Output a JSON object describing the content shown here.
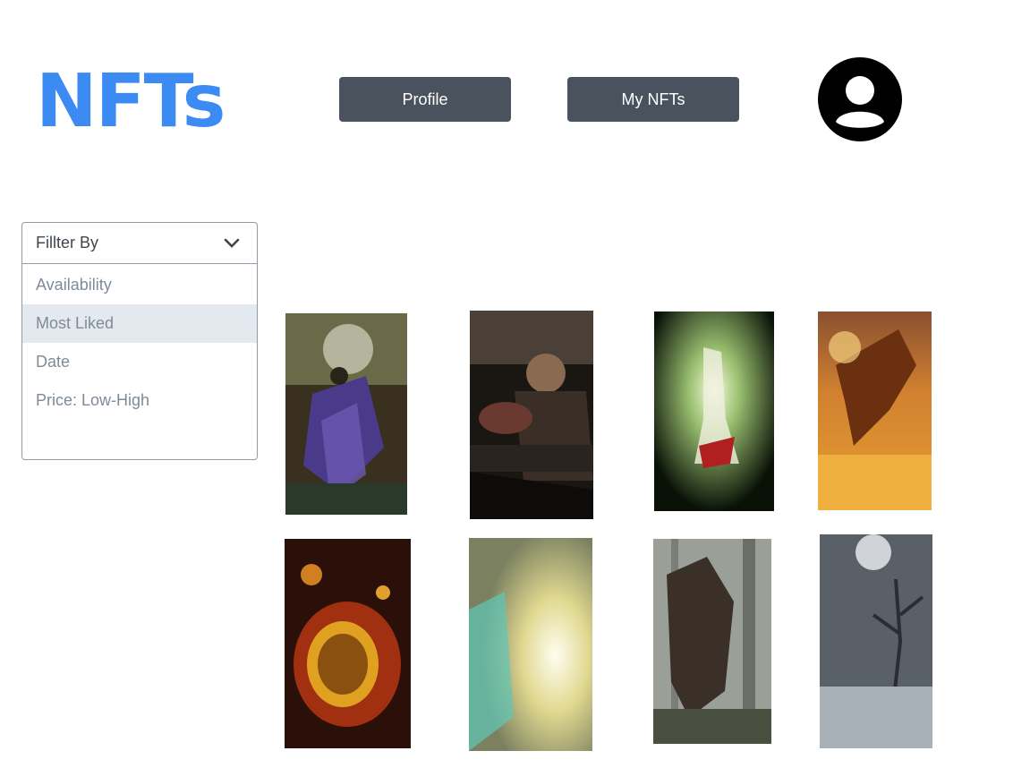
{
  "header": {
    "logo_text": "NFTs",
    "profile_label": "Profile",
    "mynfts_label": "My NFTs",
    "avatar_icon": "account-circle-icon"
  },
  "filter": {
    "title": "Fillter By",
    "options": [
      "Availability",
      "Most Liked",
      "Date",
      "Price: Low-High"
    ],
    "highlighted": "Most Liked"
  },
  "gallery": {
    "items": [
      {
        "name": "forest-warrior-nft",
        "theme": [
          "#3a3020",
          "#5a4a8a",
          "#8a7a5a"
        ]
      },
      {
        "name": "bearded-swordsman-nft",
        "theme": [
          "#1a1612",
          "#6a5040",
          "#3a2a20"
        ]
      },
      {
        "name": "radiant-knight-nft",
        "theme": [
          "#0a1208",
          "#9ac070",
          "#f4f8d8"
        ]
      },
      {
        "name": "fire-dragon-nft",
        "theme": [
          "#b84a10",
          "#f0a030",
          "#6a2a10"
        ]
      },
      {
        "name": "fire-ring-nft",
        "theme": [
          "#2a1008",
          "#e0a020",
          "#a03010"
        ]
      },
      {
        "name": "ethereal-glow-nft",
        "theme": [
          "#60b8a8",
          "#f0e8a0",
          "#a0a060"
        ]
      },
      {
        "name": "roaring-bear-nft",
        "theme": [
          "#9aa098",
          "#3a3028",
          "#5a6050"
        ]
      },
      {
        "name": "misty-forest-nft",
        "theme": [
          "#5a6068",
          "#a8b0b8",
          "#2a2e34"
        ]
      }
    ]
  }
}
